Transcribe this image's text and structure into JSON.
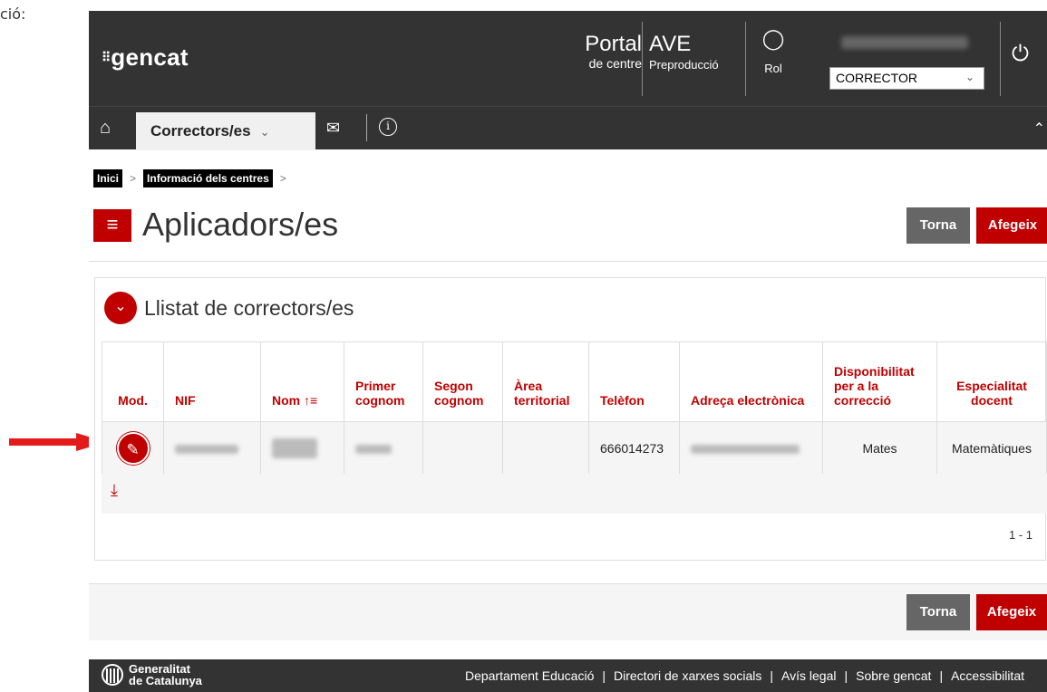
{
  "outer_label": "ció:",
  "header": {
    "logo_text": "gencat",
    "portal_big": "Portal",
    "portal_small": "de centre",
    "ave_big": "AVE",
    "ave_small": "Preproducció",
    "rol_label": "Rol",
    "role_selected": "CORRECTOR"
  },
  "nav": {
    "active_tab": "Correctors/es"
  },
  "breadcrumb": [
    "Inici",
    "Informació dels centres"
  ],
  "page": {
    "title": "Aplicadors/es",
    "torna": "Torna",
    "afegeix": "Afegeix"
  },
  "panel": {
    "title": "Llistat de correctors/es",
    "columns": [
      "Mod.",
      "NIF",
      "Nom ↑≡",
      "Primer cognom",
      "Segon cognom",
      "Àrea territorial",
      "Telèfon",
      "Adreça electrònica",
      "Disponibilitat per a la correcció",
      "Especialitat docent"
    ],
    "rows": [
      {
        "telefon": "666014273",
        "disponibilitat": "Mates",
        "especialitat": "Matemàtiques"
      }
    ],
    "pager": "1 - 1"
  },
  "footer": {
    "org_line1": "Generalitat",
    "org_line2": "de Catalunya",
    "links": [
      "Departament Educació",
      "Directori de xarxes socials",
      "Avís legal",
      "Sobre gencat",
      "Accessibilitat"
    ]
  },
  "colors": {
    "accent": "#c00000",
    "header_bg": "#333333"
  }
}
